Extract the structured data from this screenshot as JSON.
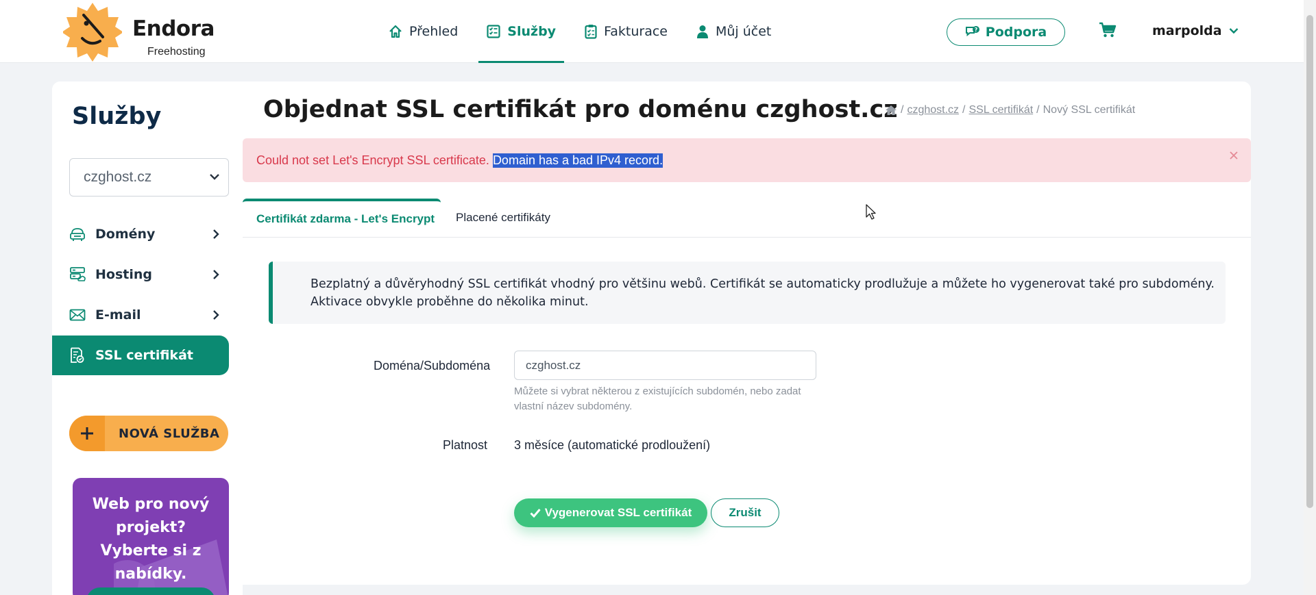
{
  "header": {
    "brand": "Endora",
    "brand_sub": "Freehosting",
    "nav": [
      {
        "label": "Přehled",
        "icon": "home-icon"
      },
      {
        "label": "Služby",
        "icon": "checklist-icon",
        "active": true
      },
      {
        "label": "Fakturace",
        "icon": "clipboard-icon"
      },
      {
        "label": "Můj účet",
        "icon": "user-icon"
      }
    ],
    "support_label": "Podpora",
    "username": "marpolda"
  },
  "sidebar": {
    "title": "Služby",
    "selected_domain": "czghost.cz",
    "items": [
      {
        "label": "Domény",
        "icon": "domain-icon"
      },
      {
        "label": "Hosting",
        "icon": "hosting-icon"
      },
      {
        "label": "E-mail",
        "icon": "mail-icon"
      },
      {
        "label": "SSL certifikát",
        "icon": "certificate-icon",
        "active": true
      }
    ],
    "new_service_label": "NOVÁ SLUŽBA",
    "promo_text": "Web pro nový projekt? Vyberte si z nabídky."
  },
  "main": {
    "title": "Objednat SSL certifikát pro doménu czghost.cz",
    "breadcrumb": {
      "crumb1": "czghost.cz",
      "crumb2": "SSL certifikát",
      "current": "Nový SSL certifikát",
      "separator": "/"
    },
    "alert": {
      "text": "Could not set Let's Encrypt SSL certificate.",
      "highlighted": "Domain has a bad IPv4 record."
    },
    "tabs": [
      {
        "label": "Certifikát zdarma - Let's Encrypt",
        "active": true
      },
      {
        "label": "Placené certifikáty",
        "active": false
      }
    ],
    "info_text": "Bezplatný a důvěryhodný SSL certifikát vhodný pro většinu webů. Certifikát se automaticky prodlužuje a můžete ho vygenerovat také pro subdomény. Aktivace obvykle proběhne do několika minut.",
    "form": {
      "domain_label": "Doména/Subdoména",
      "domain_value": "czghost.cz",
      "domain_hint": "Můžete si vybrat některou z existujících subdomén, nebo zadat vlastní název subdomény.",
      "validity_label": "Platnost",
      "validity_value": "3 měsíce (automatické prodloužení)"
    },
    "buttons": {
      "generate": "Vygenerovat SSL certifikát",
      "cancel": "Zrušit"
    }
  },
  "colors": {
    "accent": "#0b8a72",
    "orange": "#f8ae4d",
    "alert_bg": "#fadde1",
    "alert_text": "#d8384b",
    "success": "#3dc47f",
    "promo": "#7f3fb3"
  }
}
